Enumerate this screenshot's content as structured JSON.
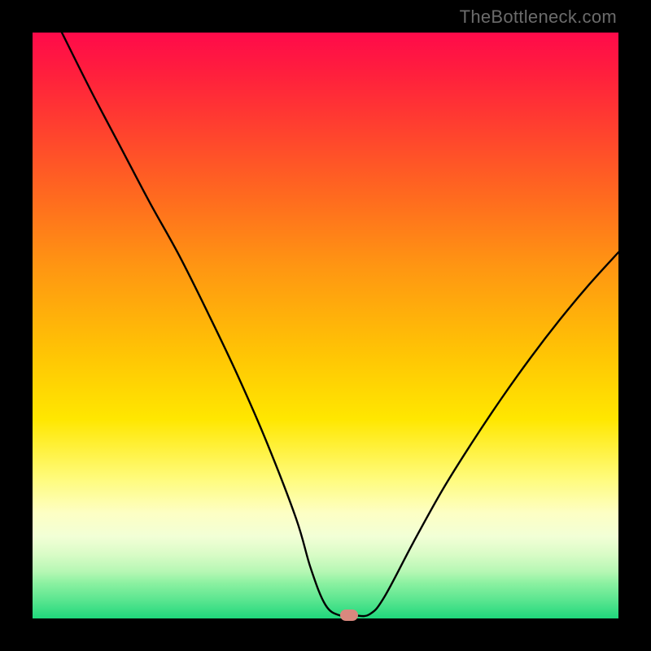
{
  "watermark": "TheBottleneck.com",
  "chart_data": {
    "type": "line",
    "title": "",
    "xlabel": "",
    "ylabel": "",
    "xlim": [
      0,
      100
    ],
    "ylim": [
      0,
      100
    ],
    "grid": false,
    "legend": false,
    "series": [
      {
        "name": "bottleneck-curve",
        "x": [
          5,
          10,
          15,
          20,
          25,
          30,
          35,
          40,
          45,
          47.5,
          50,
          52.5,
          55,
          57.5,
          60,
          65,
          70,
          75,
          80,
          85,
          90,
          95,
          100
        ],
        "values": [
          100,
          90,
          80.5,
          71,
          62,
          52,
          41.5,
          30,
          17,
          8.5,
          2.3,
          0.5,
          0.5,
          0.7,
          3.6,
          13,
          22,
          30,
          37.5,
          44.5,
          51,
          57,
          62.5
        ]
      }
    ],
    "optimum_marker": {
      "x": 54,
      "y": 0.5
    },
    "background_gradient": {
      "orientation": "vertical",
      "stops": [
        {
          "pos": 0.0,
          "color": "#ff0a4a"
        },
        {
          "pos": 0.16,
          "color": "#ff3f2f"
        },
        {
          "pos": 0.4,
          "color": "#ff9612"
        },
        {
          "pos": 0.66,
          "color": "#ffe700"
        },
        {
          "pos": 0.86,
          "color": "#f2ffd6"
        },
        {
          "pos": 1.0,
          "color": "#1fd87c"
        }
      ]
    },
    "curve_color": "#000000",
    "marker_color": "#d9887e"
  }
}
